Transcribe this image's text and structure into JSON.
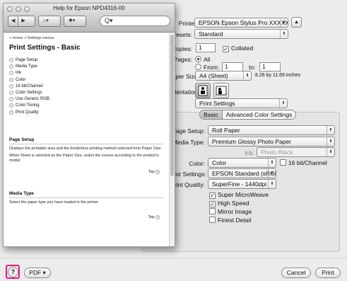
{
  "printer": {
    "label": "Printer:",
    "value": "EPSON Epson Stylus Pro XXXXX"
  },
  "presets": {
    "label": "Presets:",
    "value": "Standard"
  },
  "copies": {
    "label": "Copies:",
    "value": "1",
    "collated_label": "Collated",
    "collated": true
  },
  "pages": {
    "label": "Pages:",
    "all_label": "All",
    "from_label": "From:",
    "from_value": "1",
    "to_label": "to:",
    "to_value": "1"
  },
  "paper_size": {
    "label": "Paper Size:",
    "value": "A4 (Sheet)",
    "dims": "8.26 by 11.69 inches"
  },
  "orientation": {
    "label": "Orientation:"
  },
  "section_popup": {
    "value": "Print Settings"
  },
  "tabs": [
    {
      "label": "Basic"
    },
    {
      "label": "Advanced Color Settings"
    }
  ],
  "settings": {
    "page_setup": {
      "label": "Page Setup:",
      "value": "Roll Paper"
    },
    "media_type": {
      "label": "Media Type:",
      "value": "Premium Glossy Photo Paper"
    },
    "ink": {
      "label": "Ink:",
      "value": "Photo Black"
    },
    "color": {
      "label": "Color:",
      "value": "Color",
      "bit16_label": "16 bit/Channel"
    },
    "color_settings": {
      "label": "Color Settings:",
      "value": "EPSON Standard (sRGB)"
    },
    "print_quality": {
      "label": "Print Quality:",
      "value": "SuperFine - 1440dpi"
    },
    "checks": [
      {
        "label": "Super MicroWeave",
        "checked": true
      },
      {
        "label": "High Speed",
        "checked": true
      },
      {
        "label": "Mirror Image",
        "checked": false
      },
      {
        "label": "Finest Detail",
        "checked": false
      }
    ]
  },
  "bottom": {
    "help": "?",
    "pdf": "PDF ▾",
    "cancel": "Cancel",
    "print": "Print"
  },
  "help_window": {
    "title": "Help for Epson NPD4316-00",
    "search_glyph": "Q▾",
    "nav_back": "◀",
    "nav_forward": "▶",
    "home_glyph": "⌂▾",
    "gear_glyph": "✱▾",
    "breadcrumb": "> Home > Settings menus",
    "heading": "Print Settings - Basic",
    "toc": [
      "Page Setup",
      "Media Type",
      "Ink",
      "Color",
      "16 bit/Channel",
      "Color Settings",
      "Use Generic RGB",
      "Color Toning",
      "Print Quality"
    ],
    "sections": [
      {
        "title": "Page Setup",
        "paragraphs": [
          "Displays the printable area and the borderless printing method selected from Paper Size.",
          "When Sheet is selected as the Paper Size, select the source according to the product's model."
        ],
        "top": "Top"
      },
      {
        "title": "Media Type",
        "paragraphs": [
          "Select the paper type you have loaded in the printer."
        ],
        "top": "Top"
      }
    ]
  }
}
